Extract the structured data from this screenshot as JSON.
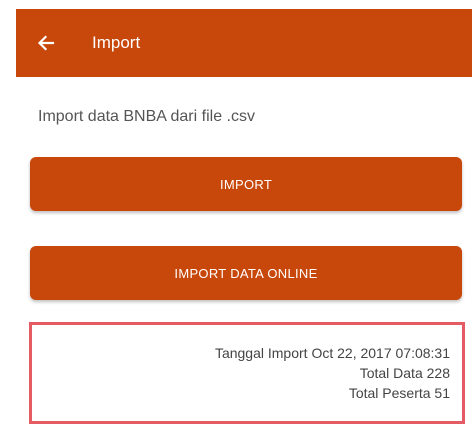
{
  "app_bar": {
    "title": "Import",
    "color": "#c8470a",
    "back_icon": "arrow-left-icon"
  },
  "main": {
    "subtitle": "Import data BNBA dari file .csv",
    "import_button": "IMPORT",
    "import_online_button": "IMPORT DATA ONLINE"
  },
  "info": {
    "tanggal_import": "Tanggal Import Oct 22, 2017 07:08:31",
    "total_data": "Total Data 228",
    "total_peserta": "Total Peserta 51",
    "highlight_color": "#e55b63"
  }
}
